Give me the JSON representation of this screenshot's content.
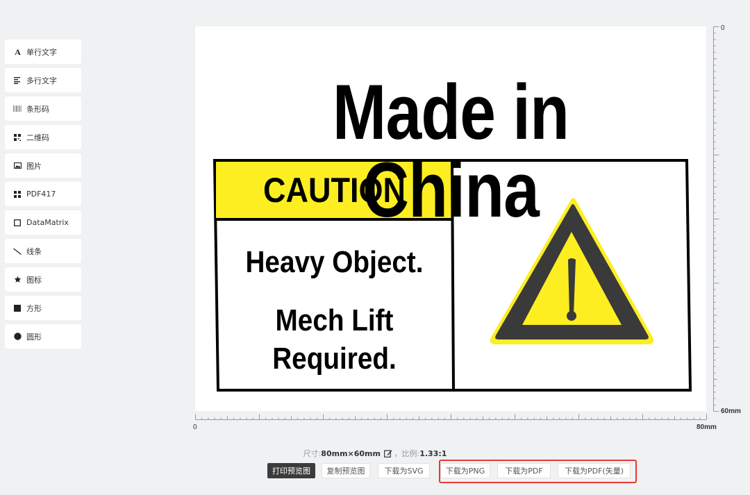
{
  "sidebar": {
    "items": [
      {
        "label": "单行文字",
        "icon": "text-a-icon"
      },
      {
        "label": "多行文字",
        "icon": "multiline-text-icon"
      },
      {
        "label": "条形码",
        "icon": "barcode-icon"
      },
      {
        "label": "二维码",
        "icon": "qrcode-icon"
      },
      {
        "label": "图片",
        "icon": "image-icon"
      },
      {
        "label": "PDF417",
        "icon": "pdf417-icon"
      },
      {
        "label": "DataMatrix",
        "icon": "datamatrix-icon"
      },
      {
        "label": "线条",
        "icon": "line-icon"
      },
      {
        "label": "图标",
        "icon": "star-icon"
      },
      {
        "label": "方形",
        "icon": "square-icon"
      },
      {
        "label": "圆形",
        "icon": "circle-icon"
      }
    ]
  },
  "label": {
    "headline": "Made in China",
    "caution": "CAUTION",
    "line1": "Heavy Object.",
    "line2": "Mech Lift",
    "line3": "Required.",
    "caution_color": "#fcee21",
    "triangle_color": "#3a3a3a",
    "symbol": "warning-triangle-icon"
  },
  "rulers": {
    "top_start": "0",
    "right_start": "0",
    "width_label": "80mm",
    "height_label": "60mm"
  },
  "info": {
    "size_prefix": "尺寸:",
    "size_value": "80mm×60mm",
    "ratio_prefix": "，比例:",
    "ratio_value": "1.33:1"
  },
  "buttons": {
    "print_preview": "打印预览图",
    "copy_preview": "复制预览图",
    "download_svg": "下载为SVG",
    "download_png": "下载为PNG",
    "download_pdf": "下载为PDF",
    "download_pdf_vector": "下载为PDF(矢量)"
  },
  "colors": {
    "highlight": "#e53935",
    "background": "#f0f1f3"
  }
}
